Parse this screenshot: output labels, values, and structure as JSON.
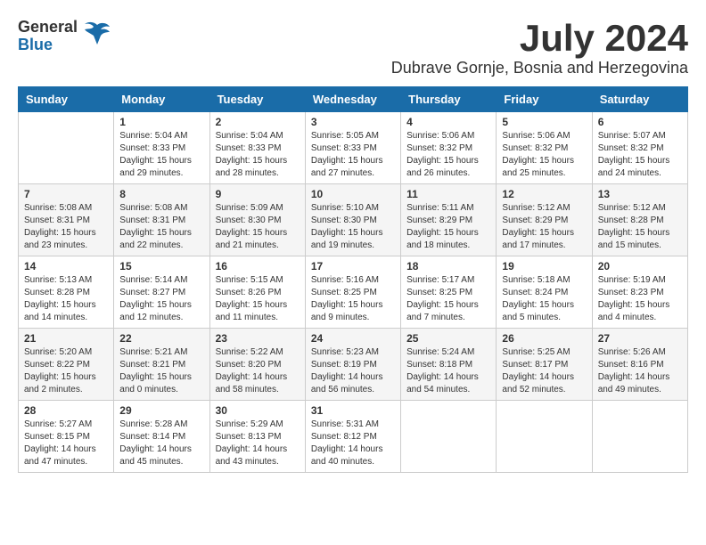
{
  "logo": {
    "general": "General",
    "blue": "Blue"
  },
  "title": {
    "month_year": "July 2024",
    "location": "Dubrave Gornje, Bosnia and Herzegovina"
  },
  "headers": [
    "Sunday",
    "Monday",
    "Tuesday",
    "Wednesday",
    "Thursday",
    "Friday",
    "Saturday"
  ],
  "weeks": [
    [
      {
        "day": "",
        "info": ""
      },
      {
        "day": "1",
        "info": "Sunrise: 5:04 AM\nSunset: 8:33 PM\nDaylight: 15 hours\nand 29 minutes."
      },
      {
        "day": "2",
        "info": "Sunrise: 5:04 AM\nSunset: 8:33 PM\nDaylight: 15 hours\nand 28 minutes."
      },
      {
        "day": "3",
        "info": "Sunrise: 5:05 AM\nSunset: 8:33 PM\nDaylight: 15 hours\nand 27 minutes."
      },
      {
        "day": "4",
        "info": "Sunrise: 5:06 AM\nSunset: 8:32 PM\nDaylight: 15 hours\nand 26 minutes."
      },
      {
        "day": "5",
        "info": "Sunrise: 5:06 AM\nSunset: 8:32 PM\nDaylight: 15 hours\nand 25 minutes."
      },
      {
        "day": "6",
        "info": "Sunrise: 5:07 AM\nSunset: 8:32 PM\nDaylight: 15 hours\nand 24 minutes."
      }
    ],
    [
      {
        "day": "7",
        "info": "Sunrise: 5:08 AM\nSunset: 8:31 PM\nDaylight: 15 hours\nand 23 minutes."
      },
      {
        "day": "8",
        "info": "Sunrise: 5:08 AM\nSunset: 8:31 PM\nDaylight: 15 hours\nand 22 minutes."
      },
      {
        "day": "9",
        "info": "Sunrise: 5:09 AM\nSunset: 8:30 PM\nDaylight: 15 hours\nand 21 minutes."
      },
      {
        "day": "10",
        "info": "Sunrise: 5:10 AM\nSunset: 8:30 PM\nDaylight: 15 hours\nand 19 minutes."
      },
      {
        "day": "11",
        "info": "Sunrise: 5:11 AM\nSunset: 8:29 PM\nDaylight: 15 hours\nand 18 minutes."
      },
      {
        "day": "12",
        "info": "Sunrise: 5:12 AM\nSunset: 8:29 PM\nDaylight: 15 hours\nand 17 minutes."
      },
      {
        "day": "13",
        "info": "Sunrise: 5:12 AM\nSunset: 8:28 PM\nDaylight: 15 hours\nand 15 minutes."
      }
    ],
    [
      {
        "day": "14",
        "info": "Sunrise: 5:13 AM\nSunset: 8:28 PM\nDaylight: 15 hours\nand 14 minutes."
      },
      {
        "day": "15",
        "info": "Sunrise: 5:14 AM\nSunset: 8:27 PM\nDaylight: 15 hours\nand 12 minutes."
      },
      {
        "day": "16",
        "info": "Sunrise: 5:15 AM\nSunset: 8:26 PM\nDaylight: 15 hours\nand 11 minutes."
      },
      {
        "day": "17",
        "info": "Sunrise: 5:16 AM\nSunset: 8:25 PM\nDaylight: 15 hours\nand 9 minutes."
      },
      {
        "day": "18",
        "info": "Sunrise: 5:17 AM\nSunset: 8:25 PM\nDaylight: 15 hours\nand 7 minutes."
      },
      {
        "day": "19",
        "info": "Sunrise: 5:18 AM\nSunset: 8:24 PM\nDaylight: 15 hours\nand 5 minutes."
      },
      {
        "day": "20",
        "info": "Sunrise: 5:19 AM\nSunset: 8:23 PM\nDaylight: 15 hours\nand 4 minutes."
      }
    ],
    [
      {
        "day": "21",
        "info": "Sunrise: 5:20 AM\nSunset: 8:22 PM\nDaylight: 15 hours\nand 2 minutes."
      },
      {
        "day": "22",
        "info": "Sunrise: 5:21 AM\nSunset: 8:21 PM\nDaylight: 15 hours\nand 0 minutes."
      },
      {
        "day": "23",
        "info": "Sunrise: 5:22 AM\nSunset: 8:20 PM\nDaylight: 14 hours\nand 58 minutes."
      },
      {
        "day": "24",
        "info": "Sunrise: 5:23 AM\nSunset: 8:19 PM\nDaylight: 14 hours\nand 56 minutes."
      },
      {
        "day": "25",
        "info": "Sunrise: 5:24 AM\nSunset: 8:18 PM\nDaylight: 14 hours\nand 54 minutes."
      },
      {
        "day": "26",
        "info": "Sunrise: 5:25 AM\nSunset: 8:17 PM\nDaylight: 14 hours\nand 52 minutes."
      },
      {
        "day": "27",
        "info": "Sunrise: 5:26 AM\nSunset: 8:16 PM\nDaylight: 14 hours\nand 49 minutes."
      }
    ],
    [
      {
        "day": "28",
        "info": "Sunrise: 5:27 AM\nSunset: 8:15 PM\nDaylight: 14 hours\nand 47 minutes."
      },
      {
        "day": "29",
        "info": "Sunrise: 5:28 AM\nSunset: 8:14 PM\nDaylight: 14 hours\nand 45 minutes."
      },
      {
        "day": "30",
        "info": "Sunrise: 5:29 AM\nSunset: 8:13 PM\nDaylight: 14 hours\nand 43 minutes."
      },
      {
        "day": "31",
        "info": "Sunrise: 5:31 AM\nSunset: 8:12 PM\nDaylight: 14 hours\nand 40 minutes."
      },
      {
        "day": "",
        "info": ""
      },
      {
        "day": "",
        "info": ""
      },
      {
        "day": "",
        "info": ""
      }
    ]
  ]
}
